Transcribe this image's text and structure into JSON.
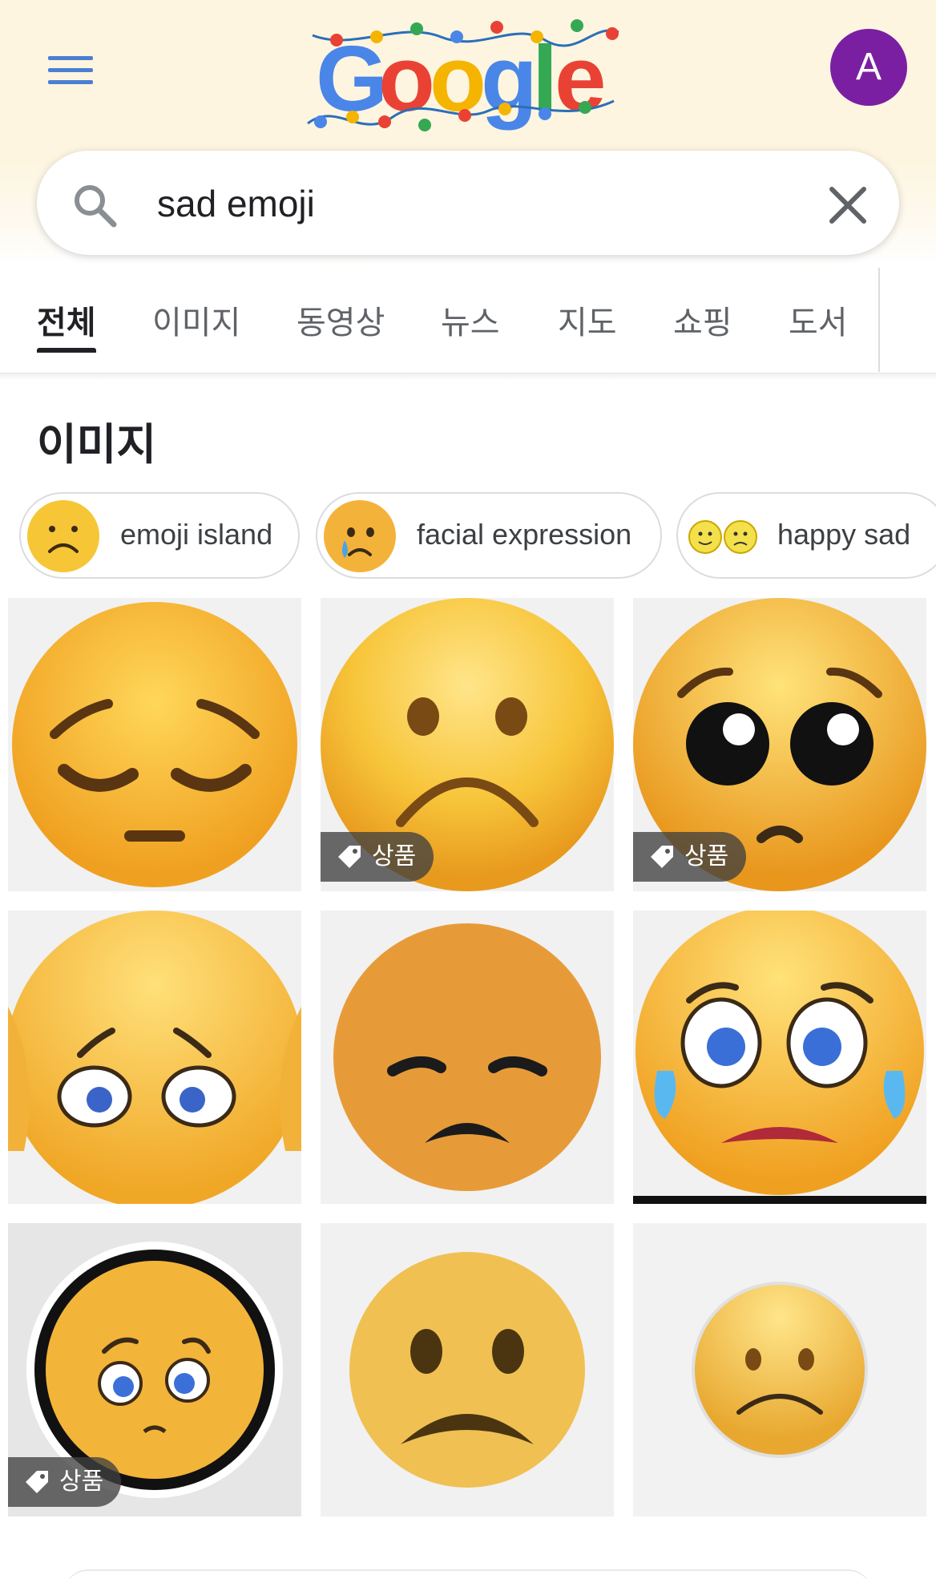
{
  "header": {
    "logo_text": "Google",
    "account_initial": "A",
    "colors": {
      "menu": "#4a7fd1",
      "avatar": "#7b1fa2"
    }
  },
  "search": {
    "value": "sad emoji",
    "icons": [
      "search-icon",
      "clear-icon"
    ]
  },
  "tabs": [
    {
      "label": "전체",
      "active": true
    },
    {
      "label": "이미지",
      "active": false
    },
    {
      "label": "동영상",
      "active": false
    },
    {
      "label": "뉴스",
      "active": false
    },
    {
      "label": "지도",
      "active": false
    },
    {
      "label": "쇼핑",
      "active": false
    },
    {
      "label": "도서",
      "active": false
    }
  ],
  "images_section": {
    "title": "이미지",
    "chips": [
      {
        "label": "emoji island"
      },
      {
        "label": "facial expression"
      },
      {
        "label": "happy sad"
      }
    ],
    "product_badge": "상품",
    "results": [
      {
        "description": "pensive face emoji",
        "badge": false
      },
      {
        "description": "frowning face emoji",
        "badge": true
      },
      {
        "description": "pleading face emoji",
        "badge": true
      },
      {
        "description": "sad emoji holding face",
        "badge": false
      },
      {
        "description": "disappointed face emoji",
        "badge": false
      },
      {
        "description": "crying face emoji",
        "badge": false
      },
      {
        "description": "pleading emoji sticker",
        "badge": true
      },
      {
        "description": "flat frowning face",
        "badge": false
      },
      {
        "description": "small frowning face",
        "badge": false
      }
    ]
  }
}
